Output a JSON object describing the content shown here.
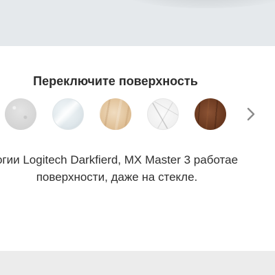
{
  "hero": {
    "image": "mouse-on-surface"
  },
  "surface_picker": {
    "title": "Переключите поверхность",
    "swatches": [
      {
        "surface": "fabric"
      },
      {
        "surface": "glass"
      },
      {
        "surface": "light-wood"
      },
      {
        "surface": "marble"
      },
      {
        "surface": "dark-wood"
      }
    ],
    "next_icon": "chevron-right-icon"
  },
  "description": {
    "line1": "огии Logitech Darkfierd, MX Master 3 работае",
    "line2": "поверхности, даже на стекле."
  },
  "colors": {
    "hero_bg": "#e5e9ec",
    "title": "#2b2b2b",
    "text": "#2e2e2e",
    "arrow": "#8a8a8a",
    "footer_bg": "#ececec"
  }
}
